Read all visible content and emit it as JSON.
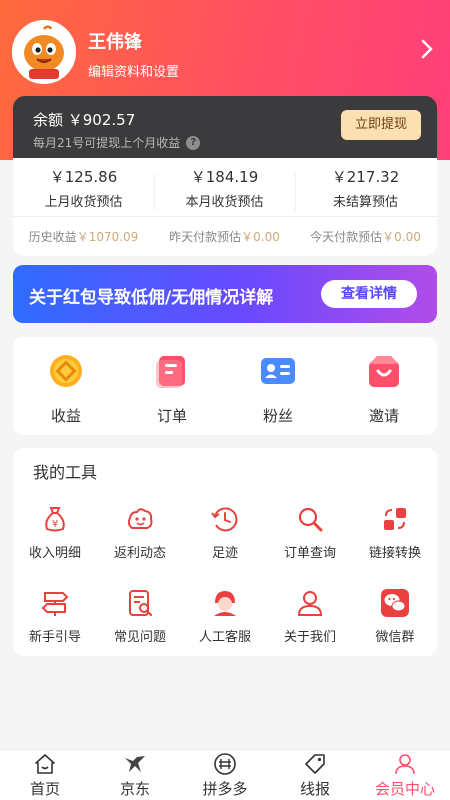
{
  "header": {
    "username": "王伟锋",
    "subtitle": "编辑资料和设置",
    "avatar_icon": "orange-mascot-avatar",
    "chevron_icon": "chevron-right-icon",
    "gradient_colors": [
      "#ff6a3d",
      "#ff3f7a"
    ]
  },
  "balance": {
    "label": "余额 ￥902.57",
    "note": "每月21号可提现上个月收益",
    "help_icon": "question-icon",
    "withdraw_label": "立即提现"
  },
  "stats": [
    {
      "value": "￥125.86",
      "label": "上月收货预估"
    },
    {
      "value": "￥184.19",
      "label": "本月收货预估"
    },
    {
      "value": "￥217.32",
      "label": "未结算预估"
    }
  ],
  "substats": [
    {
      "label": "历史收益",
      "value": "￥1070.09"
    },
    {
      "label": "昨天付款预估",
      "value": "￥0.00"
    },
    {
      "label": "今天付款预估",
      "value": "￥0.00"
    }
  ],
  "banner": {
    "text": "关于红包导致低佣/无佣情况详解",
    "button": "查看详情"
  },
  "quick": [
    {
      "label": "收益",
      "icon": "coin-icon"
    },
    {
      "label": "订单",
      "icon": "order-icon"
    },
    {
      "label": "粉丝",
      "icon": "id-card-icon"
    },
    {
      "label": "邀请",
      "icon": "gift-bag-icon"
    }
  ],
  "tools": {
    "title": "我的工具",
    "items": [
      {
        "label": "收入明细",
        "icon": "money-bag-icon"
      },
      {
        "label": "返利动态",
        "icon": "cloud-face-icon"
      },
      {
        "label": "足迹",
        "icon": "history-clock-icon"
      },
      {
        "label": "订单查询",
        "icon": "search-icon"
      },
      {
        "label": "链接转换",
        "icon": "swap-icon"
      },
      {
        "label": "新手引导",
        "icon": "signpost-icon"
      },
      {
        "label": "常见问题",
        "icon": "document-search-icon"
      },
      {
        "label": "人工客服",
        "icon": "customer-service-icon"
      },
      {
        "label": "关于我们",
        "icon": "user-icon"
      },
      {
        "label": "微信群",
        "icon": "wechat-icon"
      }
    ]
  },
  "tabbar": [
    {
      "label": "首页",
      "icon": "home-icon"
    },
    {
      "label": "京东",
      "icon": "jd-dog-icon"
    },
    {
      "label": "拼多多",
      "icon": "pdd-icon"
    },
    {
      "label": "线报",
      "icon": "tag-icon"
    },
    {
      "label": "会员中心",
      "icon": "member-icon",
      "active": true
    }
  ],
  "colors": {
    "accent": "#ff4f6b",
    "tool_icon": "#e8413f",
    "gold": "#cfa97c",
    "balance_bg": "#3b3b3d"
  }
}
